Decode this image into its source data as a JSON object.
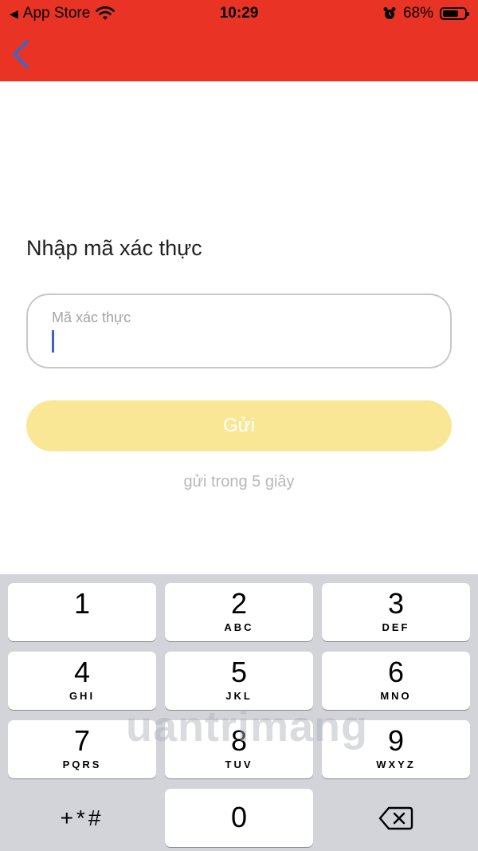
{
  "status_bar": {
    "back_app": "App Store",
    "time": "10:29",
    "battery": "68%"
  },
  "header": {
    "back_icon": "chevron-left-icon",
    "color": "#e93325"
  },
  "form": {
    "title": "Nhập mã xác thực",
    "code_placeholder": "Mã xác thực",
    "send_label": "Gửi",
    "countdown": "gửi trong 5 giây"
  },
  "keypad": {
    "keys": [
      {
        "digit": "1",
        "letters": ""
      },
      {
        "digit": "2",
        "letters": "ABC"
      },
      {
        "digit": "3",
        "letters": "DEF"
      },
      {
        "digit": "4",
        "letters": "GHI"
      },
      {
        "digit": "5",
        "letters": "JKL"
      },
      {
        "digit": "6",
        "letters": "MNO"
      },
      {
        "digit": "7",
        "letters": "PQRS"
      },
      {
        "digit": "8",
        "letters": "TUV"
      },
      {
        "digit": "9",
        "letters": "WXYZ"
      }
    ],
    "symbols": "+*#",
    "zero": "0",
    "delete_icon": "backspace-icon"
  },
  "watermark": "uantrimang"
}
